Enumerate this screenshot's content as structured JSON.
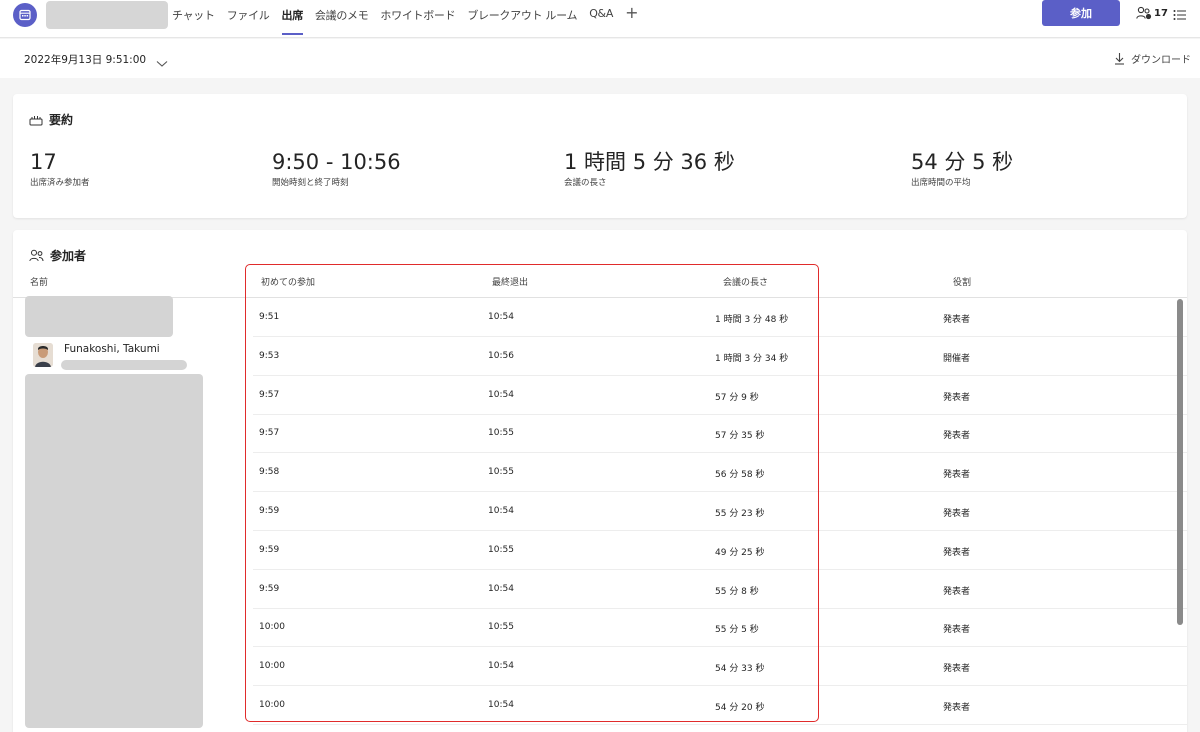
{
  "tabs": [
    {
      "label": "チャット",
      "active": false
    },
    {
      "label": "ファイル",
      "active": false
    },
    {
      "label": "出席",
      "active": true
    },
    {
      "label": "会議のメモ",
      "active": false
    },
    {
      "label": "ホワイトボード",
      "active": false
    },
    {
      "label": "ブレークアウト ルーム",
      "active": false
    },
    {
      "label": "Q&A",
      "active": false
    }
  ],
  "header": {
    "add_tab_glyph": "+",
    "join_label": "参加",
    "participant_count": "17"
  },
  "date_row": {
    "date": "2022年9月13日 9:51:00",
    "download_label": "ダウンロード"
  },
  "summary": {
    "title": "要約",
    "stats": [
      {
        "value": "17",
        "label": "出席済み参加者"
      },
      {
        "value": "9:50 - 10:56",
        "label": "開始時刻と終了時刻"
      },
      {
        "value": "1 時間 5 分 36 秒",
        "label": "会議の長さ"
      },
      {
        "value": "54 分 5 秒",
        "label": "出席時間の平均"
      }
    ]
  },
  "participants": {
    "title": "参加者",
    "columns": {
      "name": "名前",
      "first_join": "初めての参加",
      "last_leave": "最終退出",
      "duration": "会議の長さ",
      "role": "役割"
    },
    "visible_name": "Funakoshi, Takumi",
    "rows": [
      {
        "join": "9:51",
        "leave": "10:54",
        "duration": "1 時間 3 分 48 秒",
        "role": "発表者"
      },
      {
        "join": "9:53",
        "leave": "10:56",
        "duration": "1 時間 3 分 34 秒",
        "role": "開催者"
      },
      {
        "join": "9:57",
        "leave": "10:54",
        "duration": "57 分 9 秒",
        "role": "発表者"
      },
      {
        "join": "9:57",
        "leave": "10:55",
        "duration": "57 分 35 秒",
        "role": "発表者"
      },
      {
        "join": "9:58",
        "leave": "10:55",
        "duration": "56 分 58 秒",
        "role": "発表者"
      },
      {
        "join": "9:59",
        "leave": "10:54",
        "duration": "55 分 23 秒",
        "role": "発表者"
      },
      {
        "join": "9:59",
        "leave": "10:55",
        "duration": "49 分 25 秒",
        "role": "発表者"
      },
      {
        "join": "9:59",
        "leave": "10:54",
        "duration": "55 分 8 秒",
        "role": "発表者"
      },
      {
        "join": "10:00",
        "leave": "10:55",
        "duration": "55 分 5 秒",
        "role": "発表者"
      },
      {
        "join": "10:00",
        "leave": "10:54",
        "duration": "54 分 33 秒",
        "role": "発表者"
      },
      {
        "join": "10:00",
        "leave": "10:54",
        "duration": "54 分 20 秒",
        "role": "発表者"
      }
    ]
  },
  "colors": {
    "accent": "#5b5fc7",
    "highlight": "#e02b2b"
  }
}
